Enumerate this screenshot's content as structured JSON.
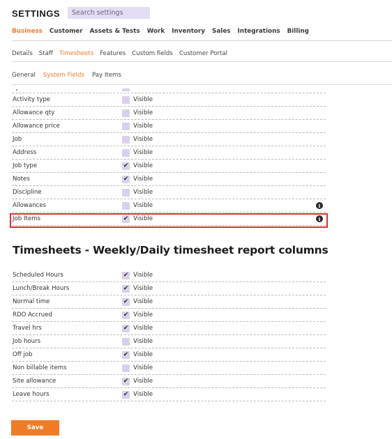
{
  "header": {
    "title": "SETTINGS",
    "search_placeholder": "Search settings"
  },
  "nav_primary": [
    {
      "label": "Business",
      "active": true
    },
    {
      "label": "Customer",
      "active": false
    },
    {
      "label": "Assets & Tests",
      "active": false
    },
    {
      "label": "Work",
      "active": false
    },
    {
      "label": "Inventory",
      "active": false
    },
    {
      "label": "Sales",
      "active": false
    },
    {
      "label": "Integrations",
      "active": false
    },
    {
      "label": "Billing",
      "active": false
    }
  ],
  "nav_secondary": [
    {
      "label": "Details",
      "active": false
    },
    {
      "label": "Staff",
      "active": false
    },
    {
      "label": "Timesheets",
      "active": true
    },
    {
      "label": "Features",
      "active": false
    },
    {
      "label": "Custom fields",
      "active": false
    },
    {
      "label": "Customer Portal",
      "active": false
    }
  ],
  "nav_tertiary": [
    {
      "label": "General",
      "active": false
    },
    {
      "label": "System Fields",
      "active": true
    },
    {
      "label": "Pay Items",
      "active": false
    }
  ],
  "system_fields": [
    {
      "label": "Activity type",
      "checked": false,
      "status": "Visible",
      "info": false
    },
    {
      "label": "Allowance qty",
      "checked": false,
      "status": "Visible",
      "info": false
    },
    {
      "label": "Allowance price",
      "checked": false,
      "status": "Visible",
      "info": false
    },
    {
      "label": "Job",
      "checked": false,
      "status": "Visible",
      "info": false
    },
    {
      "label": "Address",
      "checked": false,
      "status": "Visible",
      "info": false
    },
    {
      "label": "Job type",
      "checked": true,
      "status": "Visible",
      "info": false
    },
    {
      "label": "Notes",
      "checked": true,
      "status": "Visible",
      "info": false
    },
    {
      "label": "Discipline",
      "checked": false,
      "status": "Visible",
      "info": false
    },
    {
      "label": "Allowances",
      "checked": false,
      "status": "Visible",
      "info": true
    },
    {
      "label": "Job Items",
      "checked": true,
      "status": "Visible",
      "info": true
    }
  ],
  "report_section": {
    "title": "Timesheets - Weekly/Daily timesheet report columns"
  },
  "report_columns": [
    {
      "label": "Scheduled Hours",
      "checked": true,
      "status": "Visible"
    },
    {
      "label": "Lunch/Break Hours",
      "checked": true,
      "status": "Visible"
    },
    {
      "label": "Normal time",
      "checked": true,
      "status": "Visible"
    },
    {
      "label": "RDO Accrued",
      "checked": true,
      "status": "Visible"
    },
    {
      "label": "Travel hrs",
      "checked": true,
      "status": "Visible"
    },
    {
      "label": "Job hours",
      "checked": false,
      "status": "Visible"
    },
    {
      "label": "Off job",
      "checked": true,
      "status": "Visible"
    },
    {
      "label": "Non billable items",
      "checked": false,
      "status": "Visible"
    },
    {
      "label": "Site allowance",
      "checked": true,
      "status": "Visible"
    },
    {
      "label": "Leave hours",
      "checked": true,
      "status": "Visible"
    }
  ],
  "actions": {
    "save_label": "Save"
  },
  "icons": {
    "checkmark": "✔",
    "info": "i"
  },
  "colors": {
    "accent": "#f07b27",
    "checkbox": "#d9d0ef",
    "highlight": "#d9322a"
  }
}
